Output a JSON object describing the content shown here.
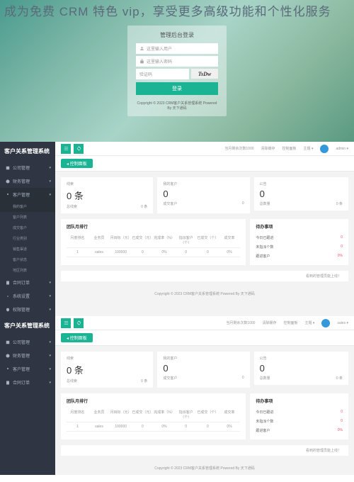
{
  "hero": "成为免费 CRM 特色 vip，享受更多高级功能和个性化服务",
  "login": {
    "title": "管理后台登录",
    "username_placeholder": "这里输入用户",
    "password_placeholder": "这里输入密码",
    "captcha_placeholder": "验证码",
    "captcha_text": "TsDw",
    "button": "登录",
    "footer": "Copyright © 2023 CRM客户关系管理系统 Powered By 天下通码"
  },
  "dash1": {
    "title": "客户关系管理系统",
    "nav": {
      "company": "公司管理",
      "finance": "财务管理",
      "customer": "客户管理",
      "my_customer": "我的客户",
      "customer_list": "客户列表",
      "deal_customer": "成交客户",
      "industry": "行业类别",
      "channel": "销售渠道",
      "status": "客户状态",
      "region": "地区列表",
      "contract": "合同订单",
      "system": "系统设置",
      "permission": "权限管理"
    },
    "topbar": {
      "remaining": "当月剩余次数1000",
      "clear_cache": "清除缓存",
      "console": "控制面板",
      "theme": "主题",
      "user": "admin"
    },
    "tab": "控制面板",
    "stats": {
      "clue": {
        "label": "线索",
        "value": "0 条",
        "sub": "总线索",
        "count": "0 条"
      },
      "my": {
        "label": "我的客户",
        "value": "0",
        "sub": "成交客户",
        "count": "0"
      },
      "announce": {
        "label": "公告",
        "value": "0",
        "sub": "总数量",
        "count": "0 条"
      }
    },
    "perf": {
      "title": "团队月排行",
      "headers": [
        "月度排名",
        "业务员",
        "月目标（元）",
        "已成交（元）",
        "完成率（%）",
        "指派客户（个）",
        "已成交（个）",
        "成交率"
      ],
      "row": [
        "1",
        "sales",
        "100000",
        "0",
        "0%",
        "0",
        "0",
        "0%"
      ]
    },
    "tasks": {
      "title": "待办事项",
      "today_follow": "今日已跟进",
      "today_follow_n": "0",
      "unassigned": "未指派个数",
      "unassigned_n": "0",
      "unfollow": "跟进客户",
      "unfollow_n": "0%"
    },
    "note": "看到的管理员能上线！",
    "footer": "Copyright © 2023 CRM客户关系管理系统 Powered By 天下通码"
  },
  "dash2": {
    "title": "客户关系管理系统",
    "nav": {
      "company": "公司管理",
      "finance": "财务管理",
      "customer": "客户管理",
      "contract": "合同订单"
    },
    "topbar": {
      "remaining": "当月剩余次数1000",
      "clear_cache": "清除缓存",
      "console": "控制面板",
      "theme": "主题",
      "user": "sales"
    },
    "tab": "控制面板",
    "footer": "Copyright © 2023 CRM客户关系管理系统 Powered By 天下通码"
  }
}
